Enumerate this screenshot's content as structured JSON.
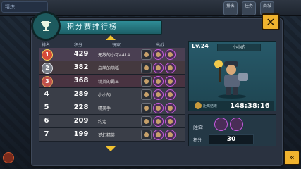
{
  "screen": {
    "title": "积分赛排行榜",
    "top_left_text": "精炼"
  },
  "top_icons": [
    {
      "label": "排名",
      "icon": "ranking-icon"
    },
    {
      "label": "任务",
      "icon": "task-icon"
    },
    {
      "label": "商城",
      "icon": "shop-icon"
    }
  ],
  "table": {
    "headers": [
      "排名",
      "积分",
      "玩家",
      "出战"
    ],
    "rows": [
      {
        "rank": "1",
        "score": "429",
        "name": "无敌的小可4414"
      },
      {
        "rank": "2",
        "score": "382",
        "name": "启萌的萌狐"
      },
      {
        "rank": "3",
        "score": "368",
        "name": "精英的霸王"
      },
      {
        "rank": "4",
        "score": "289",
        "name": "小小的"
      },
      {
        "rank": "5",
        "score": "228",
        "name": "精英手"
      },
      {
        "rank": "6",
        "score": "209",
        "name": "约定"
      },
      {
        "rank": "7",
        "score": "199",
        "name": "梦幻精英"
      }
    ]
  },
  "detail": {
    "level": "Lv.24",
    "name": "小小的",
    "timer_label": "距离结束",
    "timer": "148:38:16",
    "group_label": "阵容",
    "score_label": "积分",
    "score_value": "30"
  },
  "colors": {
    "accent": "#f0b32e",
    "title_bar": "#2f8c96",
    "panel": "#2a3240"
  }
}
